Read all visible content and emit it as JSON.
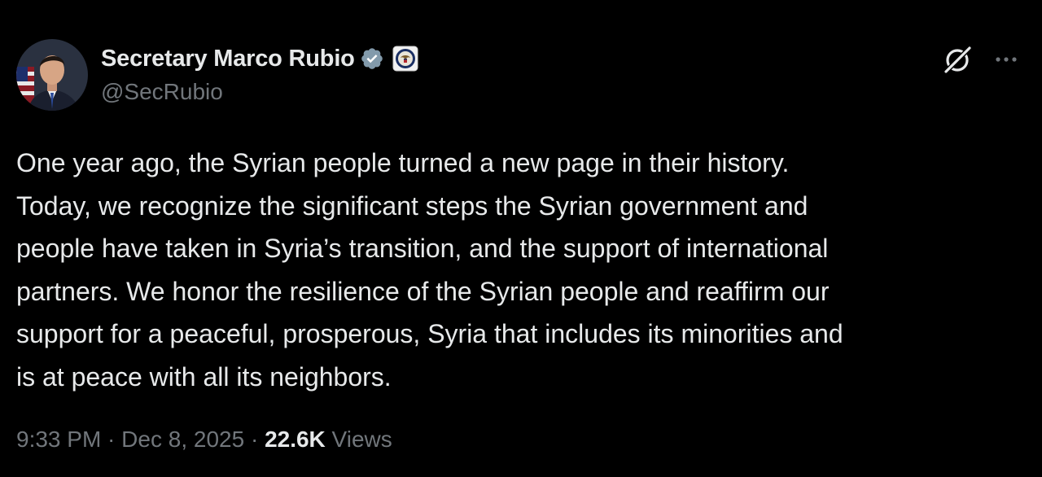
{
  "author": {
    "display_name": "Secretary Marco Rubio",
    "handle": "@SecRubio",
    "verified_color": "#829aab"
  },
  "icons": {
    "avatar": "profile-photo",
    "verified": "verified-badge-icon",
    "affiliation": "state-department-seal-icon",
    "grok": "grok-icon",
    "more": "more-options-icon"
  },
  "tweet": {
    "lines": [
      "One year ago, the Syrian people turned a new page in their history.",
      "Today, we recognize the significant steps the Syrian government and",
      "people have taken in Syria’s transition, and the support of international",
      "partners. We honor the resilience of the Syrian people and reaffirm our",
      "support for a peaceful, prosperous, Syria that includes its minorities and",
      "is at peace with all its neighbors."
    ]
  },
  "meta": {
    "time": "9:33 PM",
    "sep1": " · ",
    "date": "Dec 8, 2025",
    "sep2": " · ",
    "views_count": "22.6K",
    "views_label": " Views"
  }
}
